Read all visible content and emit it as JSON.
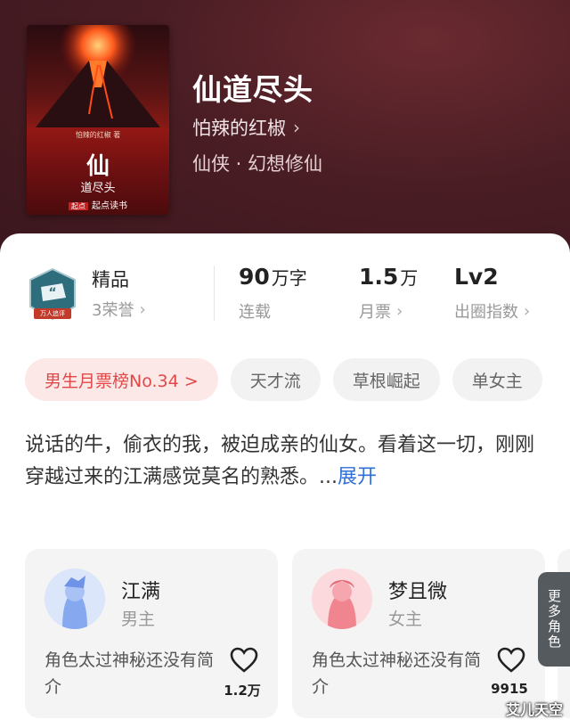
{
  "book": {
    "title": "仙道尽头",
    "author": "怕辣的红椒",
    "genre": "仙侠 · 幻想修仙",
    "cover": {
      "author_line": "怕辣的红椒 著",
      "title_char": "仙",
      "title_rest": "道尽头",
      "publisher_tag": "起点",
      "publisher": "起点读书"
    }
  },
  "stats": {
    "badge_text": "万人追评",
    "quality_label": "精品",
    "honors": "3荣誉",
    "words_value": "90",
    "words_unit": "万字",
    "words_sub": "连载",
    "tickets_value": "1.5",
    "tickets_unit": "万",
    "tickets_sub": "月票",
    "level_value": "Lv2",
    "level_sub": "出圈指数"
  },
  "tags": [
    "男生月票榜No.34 >",
    "天才流",
    "草根崛起",
    "单女主"
  ],
  "description": {
    "text": "说话的牛，偷衣的我，被迫成亲的仙女。看着这一切，刚刚穿越过来的江满感觉莫名的熟悉。...",
    "expand": "展开"
  },
  "roles": [
    {
      "name": "江满",
      "type": "男主",
      "desc": "角色太过神秘还没有简介",
      "likes": "1.2万"
    },
    {
      "name": "梦且微",
      "type": "女主",
      "desc": "角色太过神秘还没有简介",
      "likes": "9915"
    }
  ],
  "more_roles": "更多角色",
  "watermark": "艾儿天空",
  "colors": {
    "accent_blue": "#2f6fd6",
    "hot_tag": "#e04848",
    "hero_bg": "#4a1d24"
  }
}
